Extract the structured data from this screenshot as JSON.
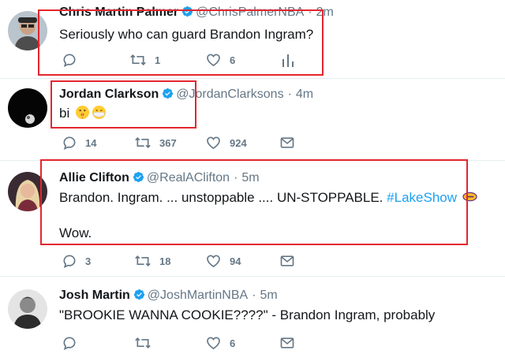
{
  "tweets": [
    {
      "name": "Chris Martin Palmer",
      "handle": "@ChrisPalmerNBA",
      "time": "2m",
      "text": "Seriously who can guard Brandon Ingram?",
      "replies": "",
      "retweets": "1",
      "likes": "6",
      "last_action": "analytics-icon"
    },
    {
      "name": "Jordan Clarkson",
      "handle": "@JordanClarksons",
      "time": "4m",
      "text": "bi",
      "emojis": [
        "shushing-face-emoji",
        "face-with-medical-mask-emoji"
      ],
      "replies": "14",
      "retweets": "367",
      "likes": "924",
      "last_action": "direct-message-icon"
    },
    {
      "name": "Allie Clifton",
      "handle": "@RealAClifton",
      "time": "5m",
      "text_line1": "Brandon. Ingram. ... unstoppable .... UN-STOPPABLE.",
      "hashtag": "#LakeShow",
      "text_line2": "Wow.",
      "replies": "3",
      "retweets": "18",
      "likes": "94",
      "last_action": "direct-message-icon"
    },
    {
      "name": "Josh Martin",
      "handle": "@JoshMartinNBA",
      "time": "5m",
      "text": "\"BROOKIE WANNA COOKIE????\" - Brandon Ingram, probably",
      "replies": "",
      "retweets": "",
      "likes": "6",
      "last_action": "direct-message-icon"
    }
  ],
  "separator": "·",
  "colors": {
    "verified": "#1da1f2",
    "hashtag": "#1da1f2",
    "secondary_text": "#657786",
    "highlight_box": "#e3262e",
    "divider": "#e6ecf0"
  }
}
